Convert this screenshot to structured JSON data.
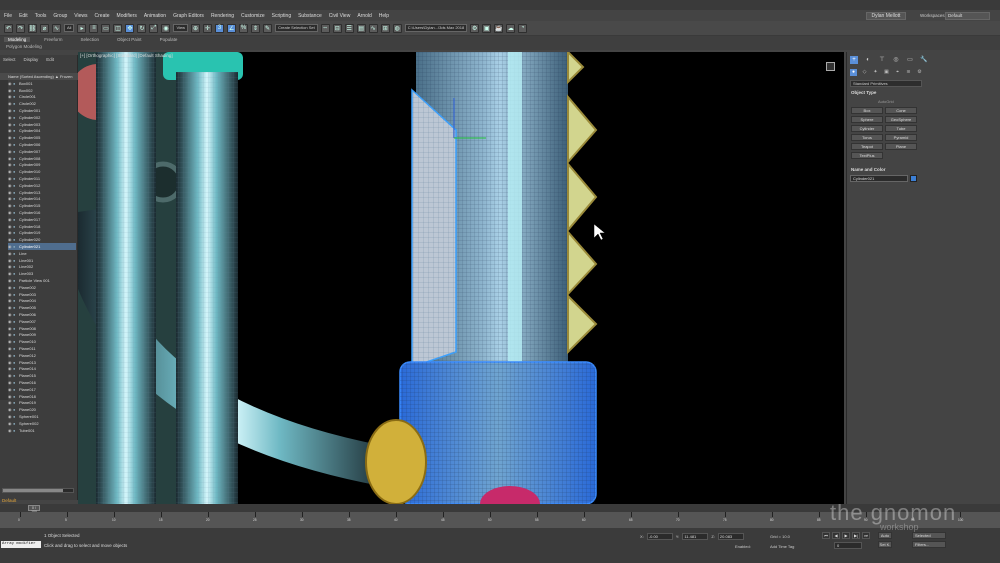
{
  "menu": [
    "File",
    "Edit",
    "Tools",
    "Group",
    "Views",
    "Create",
    "Modifiers",
    "Animation",
    "Graph Editors",
    "Rendering",
    "Customize",
    "Scripting",
    "Substance",
    "Civil View",
    "Arnold",
    "Help"
  ],
  "user": "Dylan Mellott",
  "workspaces_label": "Workspaces:",
  "workspace": "Default",
  "toolbar": {
    "filter": "All",
    "view": "View",
    "selection_set": "Create Selection Set",
    "path": "C:\\Users\\Dylan...\\3ds Max 2018"
  },
  "ribbon_tabs": [
    "Modeling",
    "Freeform",
    "Selection",
    "Object Paint",
    "Populate"
  ],
  "ribbon_sub": "Polygon Modeling",
  "explorer": {
    "tabs": [
      "Select",
      "Display",
      "Edit"
    ],
    "header": "Name (Sorted Ascending) ▲ Frozen",
    "items": [
      "Box001",
      "Box002",
      "Circle001",
      "Circle002",
      "Cylinder001",
      "Cylinder002",
      "Cylinder003",
      "Cylinder004",
      "Cylinder005",
      "Cylinder006",
      "Cylinder007",
      "Cylinder008",
      "Cylinder009",
      "Cylinder010",
      "Cylinder011",
      "Cylinder012",
      "Cylinder013",
      "Cylinder014",
      "Cylinder015",
      "Cylinder016",
      "Cylinder017",
      "Cylinder018",
      "Cylinder019",
      "Cylinder020",
      "Cylinder021",
      "Line",
      "Line001",
      "Line002",
      "Line003",
      "Particle View 001",
      "Plane002",
      "Plane003",
      "Plane004",
      "Plane005",
      "Plane006",
      "Plane007",
      "Plane008",
      "Plane009",
      "Plane010",
      "Plane011",
      "Plane012",
      "Plane013",
      "Plane014",
      "Plane015",
      "Plane016",
      "Plane017",
      "Plane018",
      "Plane019",
      "Plane020",
      "Sphere001",
      "Sphere002",
      "Tube001"
    ],
    "selected_index": 24,
    "layer": "Default",
    "frame_slider": "0 / 100"
  },
  "viewport": {
    "label": "[+] [Orthographic] [Standard] [Default Shading]"
  },
  "command_panel": {
    "dropdown": "Standard Primitives",
    "object_type": "Object Type",
    "autogrid": "AutoGrid",
    "primitives": [
      "Box",
      "Cone",
      "Sphere",
      "GeoSphere",
      "Cylinder",
      "Tube",
      "Torus",
      "Pyramid",
      "Teapot",
      "Plane",
      "TextPlus"
    ],
    "name_color": "Name and Color",
    "object_name": "Cylinder021",
    "color": "#3c7fd4"
  },
  "timeline": {
    "slider": "0 / 100",
    "ticks": [
      0,
      5,
      10,
      15,
      20,
      25,
      30,
      35,
      40,
      45,
      50,
      55,
      60,
      65,
      70,
      75,
      80,
      85,
      90,
      95,
      100
    ]
  },
  "status": {
    "script_listener": "Array modifier",
    "selected": "1 Object Selected",
    "hint": "Click and drag to select and move objects",
    "x_label": "X:",
    "x": "-0.00",
    "y_label": "Y:",
    "y": "11.481",
    "z_label": "Z:",
    "z": "20.083",
    "grid": "Grid = 10.0",
    "enabled": "Enabled:",
    "add_time_tag": "Add Time Tag",
    "frame": "0",
    "auto": "Auto",
    "setk": "Set K.",
    "selected_set": "Selected",
    "filters": "Filters..."
  },
  "watermark": {
    "brand": "the gnomon",
    "sub": "workshop"
  }
}
